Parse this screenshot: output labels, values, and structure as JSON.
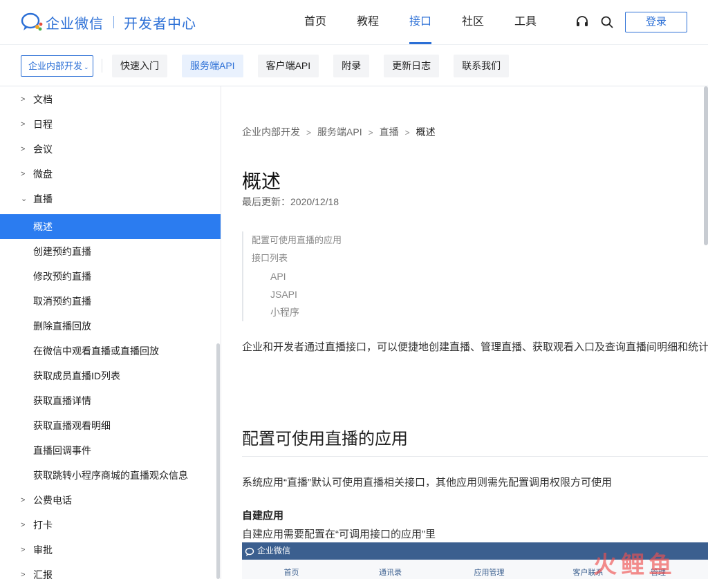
{
  "header": {
    "brand": "企业微信",
    "sub_brand": "开发者中心",
    "nav": [
      {
        "label": "首页"
      },
      {
        "label": "教程"
      },
      {
        "label": "接口",
        "active": true
      },
      {
        "label": "社区"
      },
      {
        "label": "工具"
      }
    ],
    "login_label": "登录",
    "accent_color": "#2b6fd6"
  },
  "subnav": {
    "scope_label": "企业内部开发",
    "tabs": [
      {
        "label": "快速入门"
      },
      {
        "label": "服务端API",
        "active": true
      },
      {
        "label": "客户端API"
      },
      {
        "label": "附录"
      },
      {
        "label": "更新日志"
      },
      {
        "label": "联系我们"
      }
    ]
  },
  "sidebar": {
    "items": [
      {
        "label": "文档",
        "type": "group"
      },
      {
        "label": "日程",
        "type": "group"
      },
      {
        "label": "会议",
        "type": "group"
      },
      {
        "label": "微盘",
        "type": "group"
      },
      {
        "label": "直播",
        "type": "group",
        "expanded": true
      },
      {
        "label": "概述",
        "type": "child",
        "active": true
      },
      {
        "label": "创建预约直播",
        "type": "child"
      },
      {
        "label": "修改预约直播",
        "type": "child"
      },
      {
        "label": "取消预约直播",
        "type": "child"
      },
      {
        "label": "删除直播回放",
        "type": "child"
      },
      {
        "label": "在微信中观看直播或直播回放",
        "type": "child"
      },
      {
        "label": "获取成员直播ID列表",
        "type": "child"
      },
      {
        "label": "获取直播详情",
        "type": "child"
      },
      {
        "label": "获取直播观看明细",
        "type": "child"
      },
      {
        "label": "直播回调事件",
        "type": "child"
      },
      {
        "label": "获取跳转小程序商城的直播观众信息",
        "type": "child"
      },
      {
        "label": "公费电话",
        "type": "group"
      },
      {
        "label": "打卡",
        "type": "group"
      },
      {
        "label": "审批",
        "type": "group"
      },
      {
        "label": "汇报",
        "type": "group"
      }
    ],
    "active_color": "#2b7cf0"
  },
  "content": {
    "breadcrumb": [
      "企业内部开发",
      "服务端API",
      "直播",
      "概述"
    ],
    "title": "概述",
    "updated": "最后更新：2020/12/18",
    "toc": [
      {
        "label": "配置可使用直播的应用",
        "level": 1
      },
      {
        "label": "接口列表",
        "level": 1
      },
      {
        "label": "API",
        "level": 2
      },
      {
        "label": "JSAPI",
        "level": 2
      },
      {
        "label": "小程序",
        "level": 2
      }
    ],
    "intro": "企业和开发者通过直播接口，可以便捷地创建直播、管理直播、获取观看入口及查询直播间明细和统计",
    "section_title": "配置可使用直播的应用",
    "section_para": "系统应用“直播”默认可使用直播相关接口，其他应用则需先配置调用权限方可使用",
    "subsection_title": "自建应用",
    "subsection_para": "自建应用需要配置在“可调用接口的应用”里",
    "embed": {
      "brand": "企业微信",
      "nav": [
        "首页",
        "通讯录",
        "应用管理",
        "客户联系",
        "管理"
      ]
    }
  },
  "watermark": "火鲤鱼"
}
